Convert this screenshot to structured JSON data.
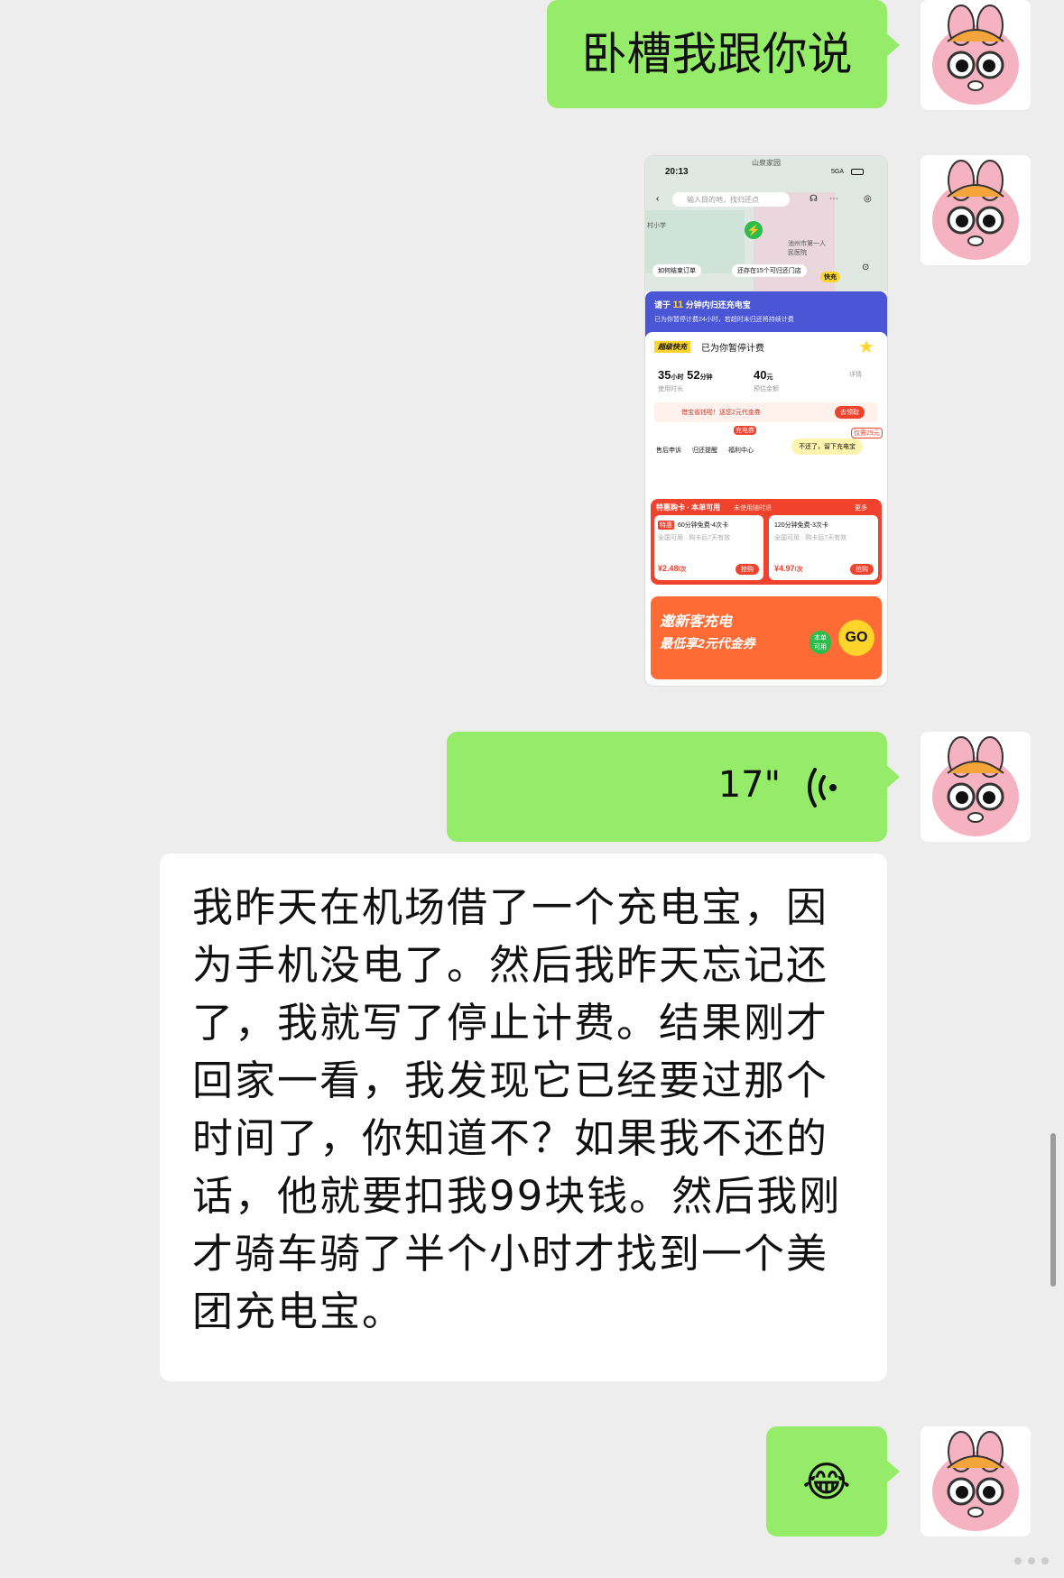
{
  "messages": {
    "m1": "卧槽我跟你说",
    "voice_duration": "17\"",
    "long_text": "我昨天在机场借了一个充电宝，因为手机没电了。然后我昨天忘记还了，我就写了停止计费。结果刚才回家一看，我发现它已经要过那个时间了，你知道不？如果我不还的话，他就要扣我99块钱。然后我刚才骑车骑了半个小时才找到一个美团充电宝。",
    "emoji": "😂"
  },
  "screenshot": {
    "location": "山泉家园",
    "time": "20:13",
    "signal": "5GA",
    "search_placeholder": "输入目的地，找归还点",
    "map_label_1": "村小学",
    "map_label_2": "池州市第一人民医院",
    "how_end_order": "如何结束订单",
    "nearby": "还存在15个可归还门店",
    "brand_badge": "快充",
    "return_title_pre": "请于",
    "return_minutes": "11",
    "return_title_post": "分钟内归还充电宝",
    "return_subtitle": "已为你暂停计费24小时，若超时未归还将持续计费",
    "super_badge": "超级快充",
    "paused_text": "已为你暂停计费",
    "duration_h": "35",
    "unit_h": "小时",
    "duration_m": "52",
    "unit_m": "分钟",
    "duration_label": "使用时长",
    "amount": "40",
    "unit_yuan": "元",
    "amount_label": "预估金额",
    "detail": "详情",
    "coupon_tip": "借宝省钱啦！送您2元代金券",
    "coupon_btn": "去领取",
    "actions": [
      "售后申诉",
      "归还提醒",
      "福利中心"
    ],
    "action_badge": "充电券",
    "keep_btn": "不还了，留下充电宝",
    "keep_badge": "仅需29元",
    "card_header": "特惠购卡 · 本单可用",
    "card_header_sub": "未使用随时退",
    "card_more": "更多",
    "card1_title": "60分钟免费-4次卡",
    "card1_tag": "特惠",
    "card1_sub": "全国可用 · 购卡后7天有效",
    "card1_price": "¥2.48",
    "card1_unit": "/次",
    "card1_btn": "抢购",
    "card2_title": "120分钟免费-3次卡",
    "card2_sub": "全国可用 · 购卡后7天有效",
    "card2_price": "¥4.97",
    "card2_unit": "/次",
    "card2_btn": "抢购",
    "banner_l1": "邀新客充电",
    "banner_l2": "最低享2元代金券",
    "banner_badge": "本单可用",
    "banner_go": "GO"
  },
  "colors": {
    "bubble_green": "#95ec69",
    "background": "#ededed",
    "accent_blue": "#4a56d6",
    "accent_red": "#f0422c",
    "accent_yellow": "#ffd52b"
  }
}
